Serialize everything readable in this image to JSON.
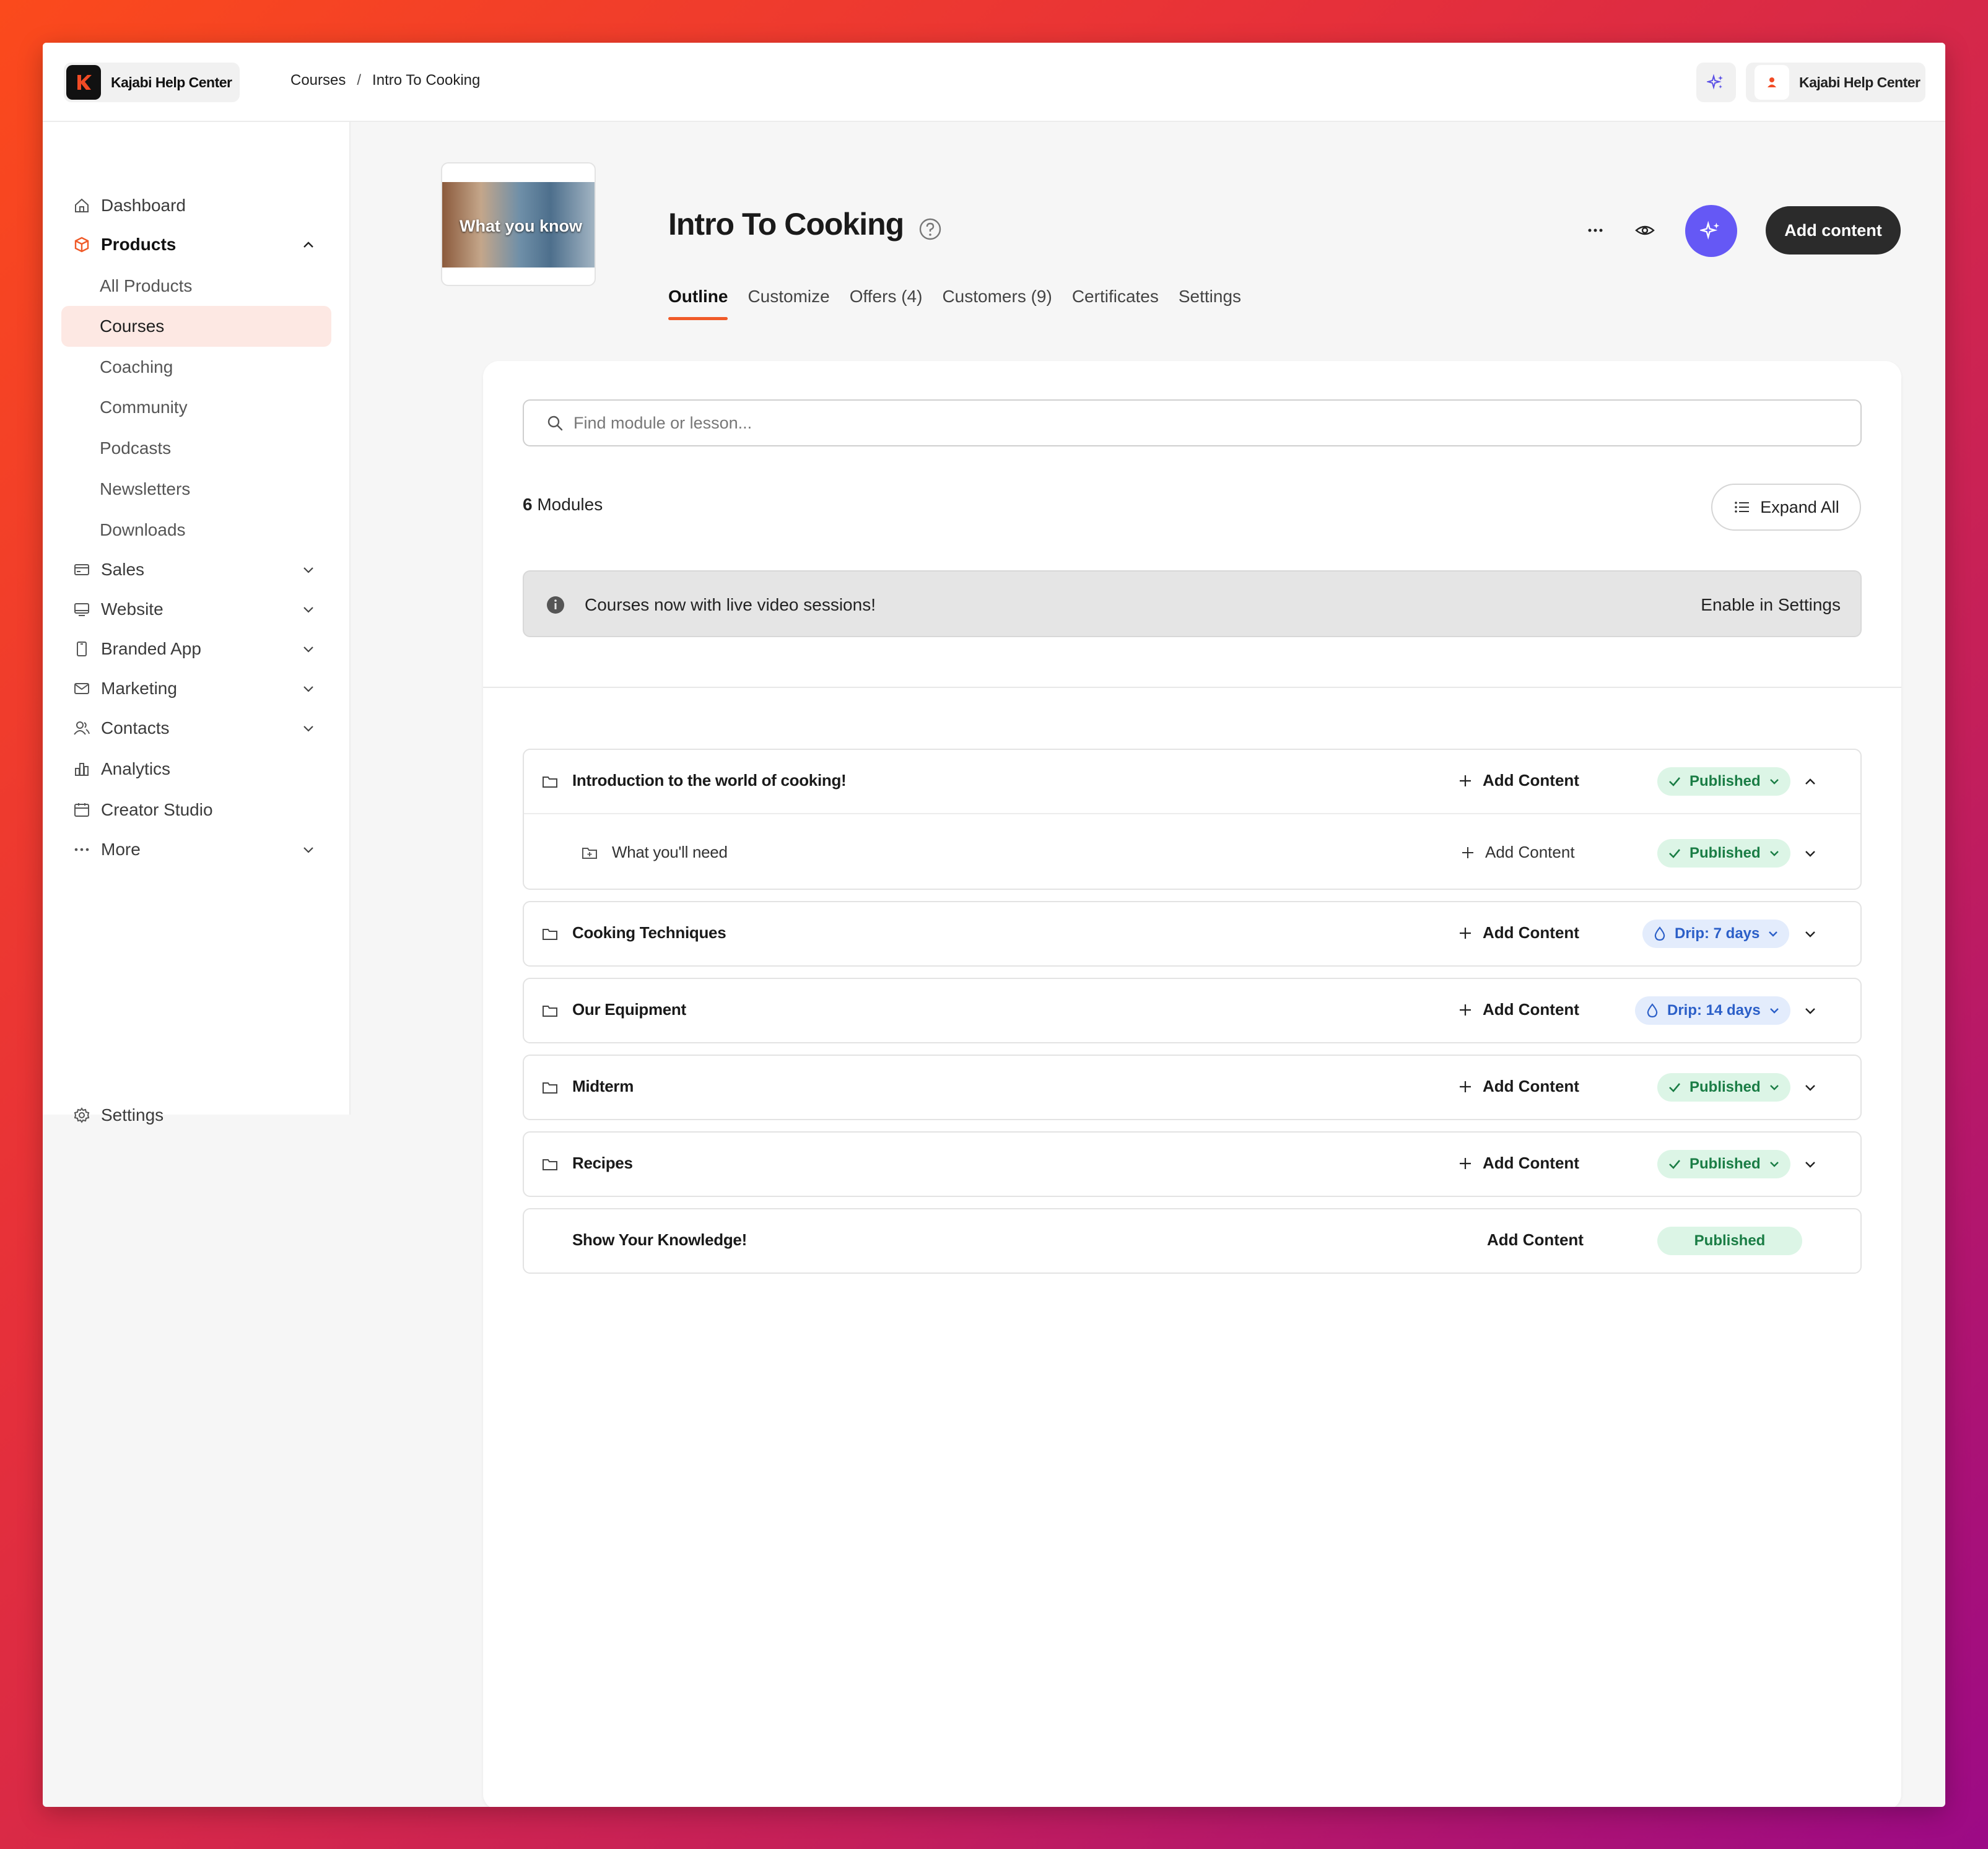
{
  "brand": {
    "name": "Kajabi Help Center"
  },
  "breadcrumb": {
    "parent": "Courses",
    "separator": "/",
    "current": "Intro To Cooking"
  },
  "account": {
    "name": "Kajabi Help Center"
  },
  "sidebar": {
    "items": [
      {
        "label": "Dashboard"
      },
      {
        "label": "Products"
      },
      {
        "label": "Sales"
      },
      {
        "label": "Website"
      },
      {
        "label": "Branded App"
      },
      {
        "label": "Marketing"
      },
      {
        "label": "Contacts"
      },
      {
        "label": "Analytics"
      },
      {
        "label": "Creator Studio"
      },
      {
        "label": "More"
      }
    ],
    "products_sub": [
      {
        "label": "All Products"
      },
      {
        "label": "Courses"
      },
      {
        "label": "Coaching"
      },
      {
        "label": "Community"
      },
      {
        "label": "Podcasts"
      },
      {
        "label": "Newsletters"
      },
      {
        "label": "Downloads"
      }
    ],
    "settings": "Settings"
  },
  "course": {
    "thumbnail_text": "What you know",
    "title": "Intro To Cooking",
    "tabs": [
      "Outline",
      "Customize",
      "Offers (4)",
      "Customers (9)",
      "Certificates",
      "Settings"
    ],
    "add_content_label": "Add content"
  },
  "outline": {
    "search_placeholder": "Find module or lesson...",
    "modules_count": "6",
    "modules_label": "Modules",
    "expand_all": "Expand All",
    "banner_message": "Courses now with live video sessions!",
    "banner_action": "Enable in Settings",
    "add_content": "Add Content",
    "modules": [
      {
        "name": "Introduction to the world of cooking!",
        "status": "Published"
      },
      {
        "name": "What you'll need",
        "status": "Published"
      },
      {
        "name": "Cooking Techniques",
        "status": "Drip: 7 days"
      },
      {
        "name": "Our Equipment",
        "status": "Drip: 14 days"
      },
      {
        "name": "Midterm",
        "status": "Published"
      },
      {
        "name": "Recipes",
        "status": "Published"
      },
      {
        "name": "Show Your Knowledge!",
        "status": "Published"
      }
    ]
  },
  "colors": {
    "accent": "#f05a28",
    "ai": "#6558f5",
    "published_bg": "#dcf5e6",
    "drip_bg": "#e3ecfc"
  }
}
